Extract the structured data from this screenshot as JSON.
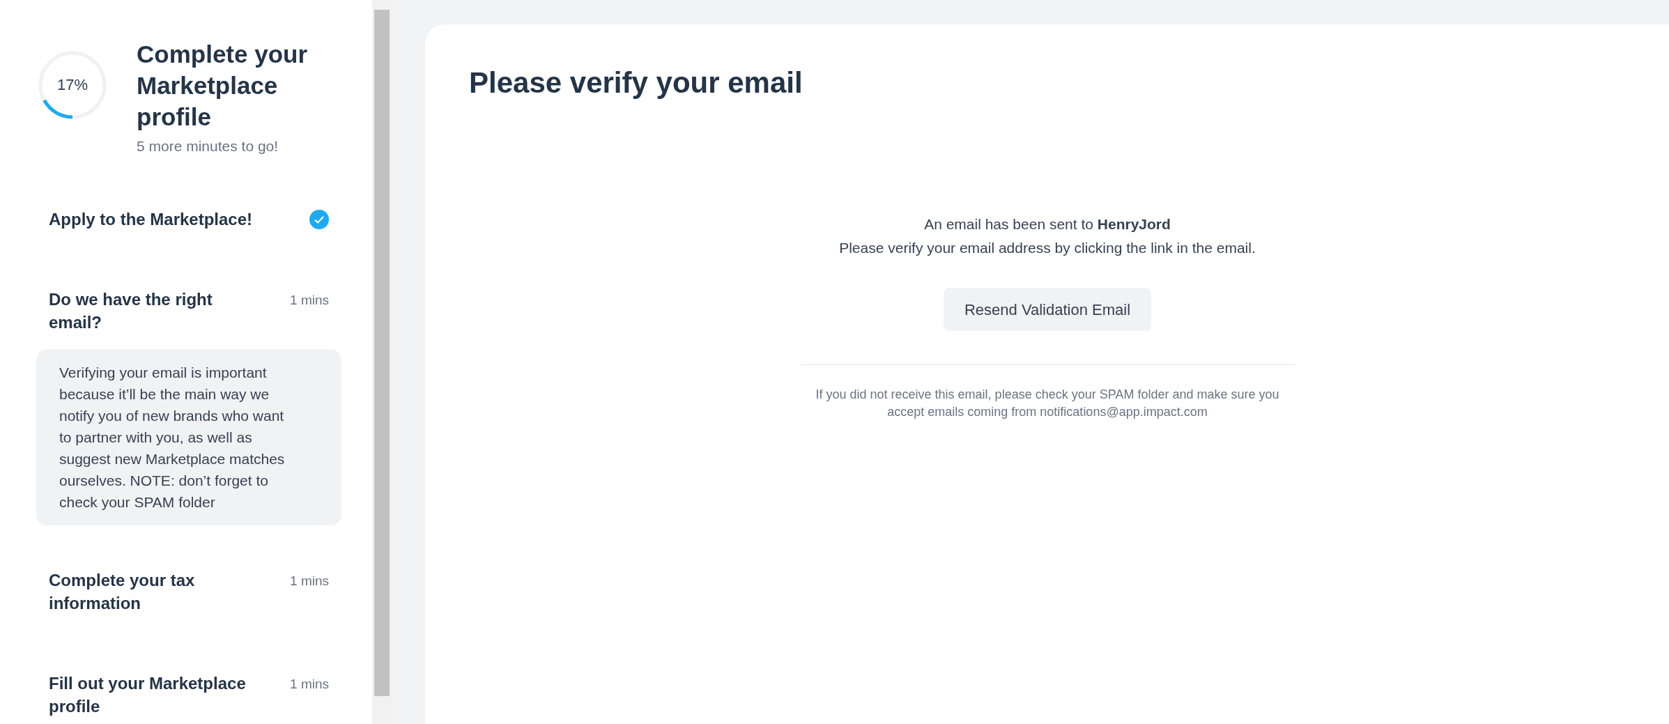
{
  "progress": {
    "reading": "17%",
    "title": "Complete your Marketplace profile",
    "subtitle": "5 more minutes to go!"
  },
  "steps": [
    {
      "title": "Apply to the Marketplace!",
      "completed": true
    },
    {
      "title": "Do we have the right email?",
      "completed": false,
      "duration": "1 mins",
      "description": "Verifying your email is important because it’ll be the main way we notify you of new brands who want to partner with you, as well as suggest new Marketplace matches ourselves. NOTE: don’t forget to check your SPAM folder"
    },
    {
      "title": "Complete your tax information",
      "completed": false,
      "duration": "1 mins"
    },
    {
      "title": "Fill out your Marketplace profile",
      "completed": false,
      "duration": "1 mins"
    }
  ],
  "main": {
    "title": "Please verify your email",
    "sent_line": "An email has been sent to **HenryJord**",
    "instruction": "Please verify your email address by clicking the link in the email.",
    "resend_button": "Resend Validation Email",
    "note": "If you did not receive this email, please check your SPAM folder and make sure you accept emails coming from notifications@app.impact.com"
  }
}
